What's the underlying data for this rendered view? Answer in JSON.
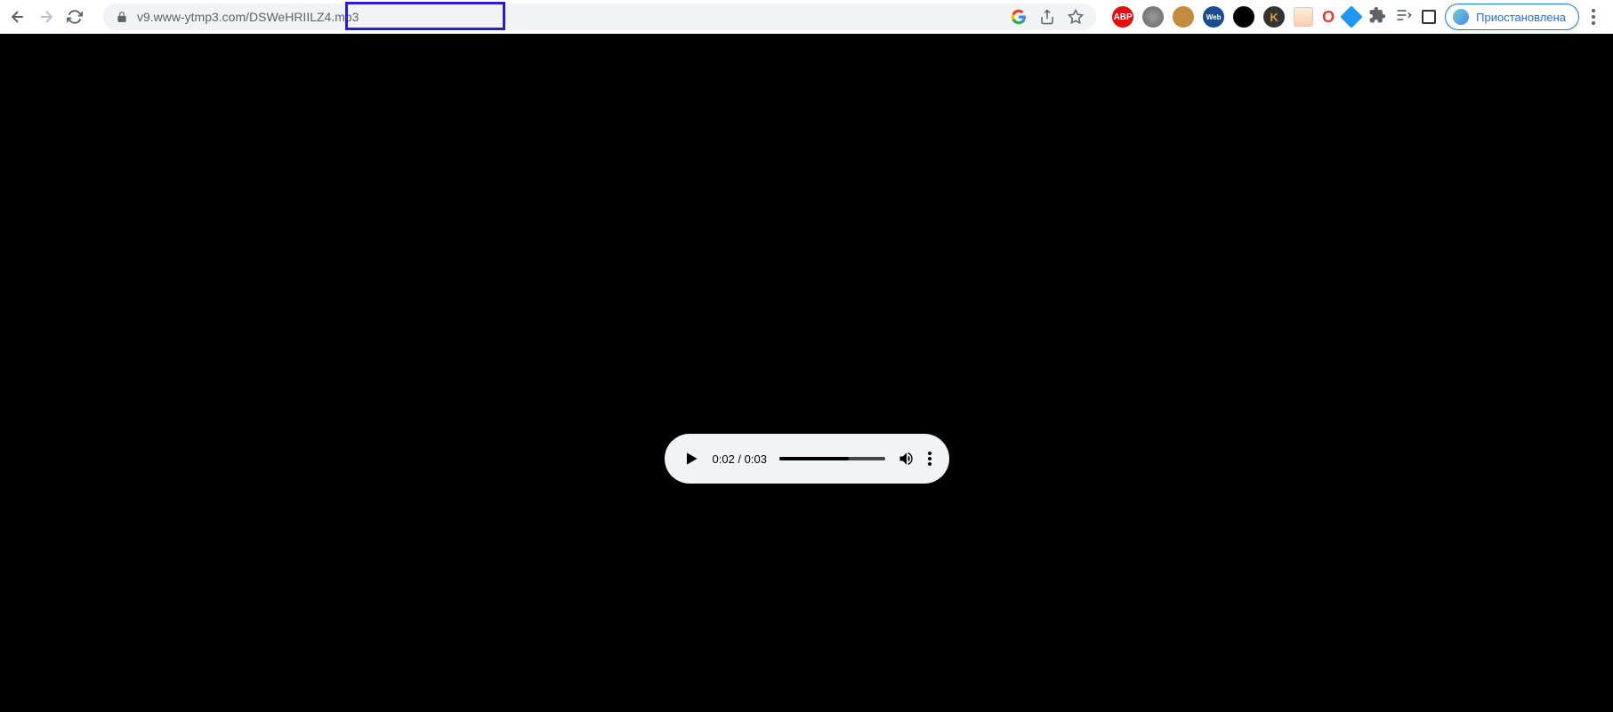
{
  "url": "v9.www-ytmp3.com/DSWeHRIILZ4.mp3",
  "profile_status": "Приостановлена",
  "extensions": {
    "abp_label": "ABP",
    "web_label": "Web",
    "k_label": "K",
    "o_label": "O"
  },
  "player": {
    "current_time": "0:02",
    "duration": "0:03",
    "time_display": "0:02 / 0:03",
    "progress_percent": 66
  }
}
